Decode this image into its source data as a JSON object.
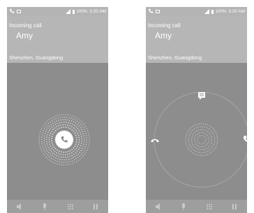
{
  "status": {
    "battery": "100%",
    "time": "3:20 AM"
  },
  "call": {
    "title": "Incoming call",
    "caller": "Amy",
    "location": "Shenzhen, Guangdong"
  },
  "icons": {
    "status_left": [
      "phone-icon",
      "screen-icon"
    ],
    "status_right": [
      "signal-icon",
      "battery-icon"
    ],
    "bottom_bar": [
      "speaker-icon",
      "mic-icon",
      "keypad-icon",
      "hold-icon"
    ],
    "actions": [
      "message-icon",
      "decline-icon",
      "answer-icon"
    ]
  },
  "colors": {
    "header": "#b6b6b6",
    "body": "#8d8d8d",
    "statusbar": "#b4b4b4",
    "accent": "#ffffff"
  }
}
